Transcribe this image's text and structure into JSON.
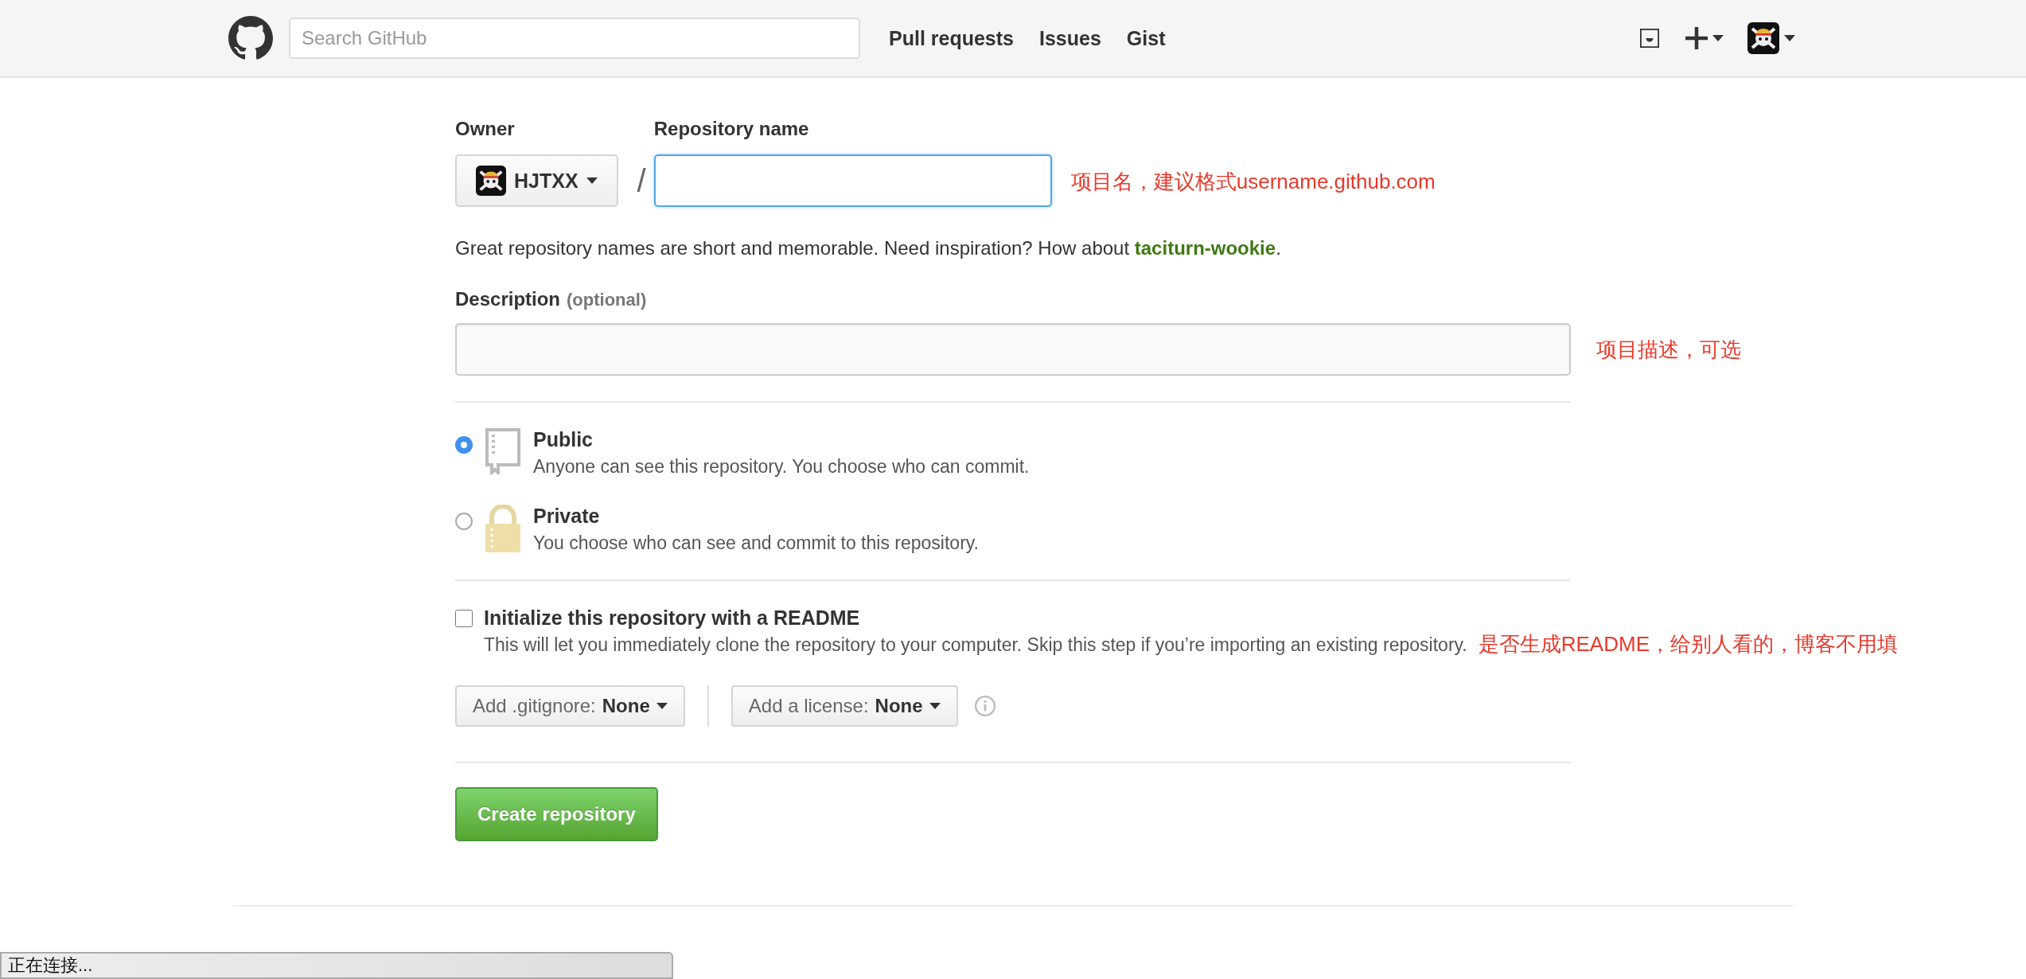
{
  "header": {
    "search": {
      "placeholder": "Search GitHub"
    },
    "nav": [
      "Pull requests",
      "Issues",
      "Gist"
    ]
  },
  "form": {
    "owner": {
      "label": "Owner",
      "value": "HJTXX"
    },
    "separator": "/",
    "repo_name": {
      "label": "Repository name",
      "focused": true,
      "note": "项目名，建议格式username.github.com"
    },
    "hint": "Great repository names are short and memorable. Need inspiration? How about **taciturn-wookie**.",
    "description": {
      "label": "Description",
      "optional": "(optional)",
      "note": "项目描述，可选"
    },
    "visibility": [
      {
        "kind": "public",
        "title": "Public",
        "text": "Anyone can see this repository. You choose who can commit.",
        "selected": true
      },
      {
        "kind": "private",
        "title": "Private",
        "text": "You choose who can see and commit to this repository.",
        "selected": false
      }
    ],
    "readme": {
      "label": "Initialize this repository with a README",
      "text": "This will let you immediately clone the repository to your computer. Skip this step if you’re importing an existing repository.",
      "note": "是否生成README，给别人看的，博客不用填",
      "checked": false
    },
    "gitignore": {
      "label": "Add .gitignore:",
      "value": "None"
    },
    "license": {
      "label": "Add a license:",
      "value": "None"
    },
    "submit": "Create repository"
  },
  "status_bar": "正在连接..."
}
